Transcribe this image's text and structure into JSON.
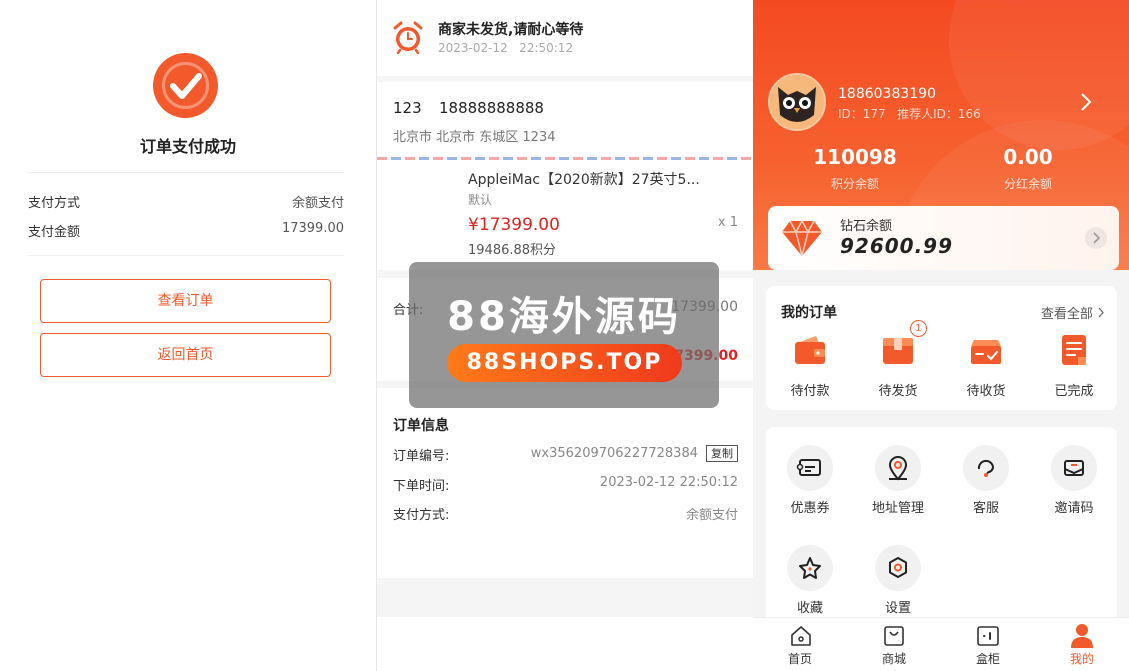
{
  "payment_success": {
    "title": "订单支付成功",
    "rows": [
      {
        "label": "支付方式",
        "value": "余额支付"
      },
      {
        "label": "支付金额",
        "value": "17399.00"
      }
    ],
    "view_order_button": "查看订单",
    "back_home_button": "返回首页",
    "accent": "#f25a2c"
  },
  "order_detail": {
    "status_title": "商家未发货,请耐心等待",
    "status_time": "2023-02-12   22:50:12",
    "address": {
      "name": "123",
      "phone": "18888888888",
      "detail": "北京市 北京市 东城区 1234"
    },
    "goods": {
      "name": "AppleiMac【2020新款】27英寸5...",
      "spec": "默认",
      "price": "¥17399.00",
      "qty": "x 1",
      "points": "19486.88积分"
    },
    "total_label": "合计:",
    "total_value": "17399.00",
    "pay_value": "7399.00",
    "info": {
      "title": "订单信息",
      "rows": [
        {
          "label": "订单编号:",
          "value": "wx356209706227728384"
        },
        {
          "label": "下单时间:",
          "value": "2023-02-12 22:50:12"
        },
        {
          "label": "支付方式:",
          "value": "余额支付"
        }
      ],
      "copy_label": "复制"
    }
  },
  "watermark": {
    "title": "88海外源码",
    "url": "88SHOPS.TOP"
  },
  "profile": {
    "phone": "18860383190",
    "id_line": "ID：177   推荐人ID：166",
    "stats": [
      {
        "value": "110098",
        "label": "积分余额"
      },
      {
        "value": "0.00",
        "label": "分红余额"
      }
    ],
    "diamond": {
      "label": "钻石余额",
      "value": "92600.99"
    },
    "orders": {
      "title": "我的订单",
      "more": "查看全部",
      "items": [
        {
          "label": "待付款",
          "icon": "wallet-icon"
        },
        {
          "label": "待发货",
          "icon": "package-icon",
          "badge": "1"
        },
        {
          "label": "待收货",
          "icon": "truck-icon"
        },
        {
          "label": "已完成",
          "icon": "document-icon"
        }
      ]
    },
    "services": [
      {
        "label": "优惠券",
        "icon": "coupon-icon"
      },
      {
        "label": "地址管理",
        "icon": "location-icon"
      },
      {
        "label": "客服",
        "icon": "headset-icon"
      },
      {
        "label": "邀请码",
        "icon": "envelope-icon"
      },
      {
        "label": "收藏",
        "icon": "star-icon"
      },
      {
        "label": "设置",
        "icon": "gear-icon"
      }
    ],
    "tabs": [
      {
        "label": "首页",
        "icon": "home-icon"
      },
      {
        "label": "商城",
        "icon": "shopping-bag-icon"
      },
      {
        "label": "盒柜",
        "icon": "cabinet-icon"
      },
      {
        "label": "我的",
        "icon": "user-icon",
        "active": true
      }
    ]
  }
}
